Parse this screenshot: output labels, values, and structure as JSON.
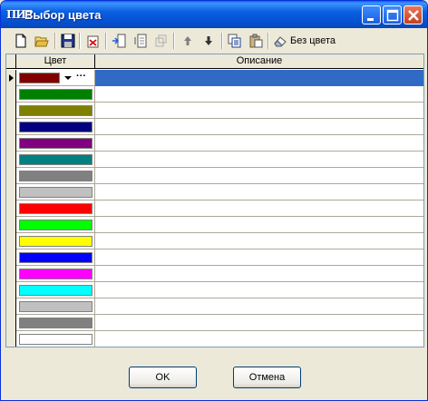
{
  "window": {
    "title": "Выбор цвета",
    "app_icon_text": "ПИР"
  },
  "toolbar": {
    "no_color_label": "Без цвета",
    "icons": [
      "new-icon",
      "open-icon",
      "save-icon",
      "delete-icon",
      "insert-icon",
      "copy-row-icon",
      "paste-row-icon",
      "move-up-icon",
      "move-down-icon",
      "copy-icon",
      "paste-icon",
      "eraser-icon"
    ]
  },
  "grid": {
    "columns": [
      "Цвет",
      "Описание"
    ],
    "rows": [
      {
        "color": "#800000",
        "description": "",
        "selected": true
      },
      {
        "color": "#008000",
        "description": ""
      },
      {
        "color": "#808000",
        "description": ""
      },
      {
        "color": "#000080",
        "description": ""
      },
      {
        "color": "#800080",
        "description": ""
      },
      {
        "color": "#008080",
        "description": ""
      },
      {
        "color": "#808080",
        "description": ""
      },
      {
        "color": "#c0c0c0",
        "description": ""
      },
      {
        "color": "#ff0000",
        "description": ""
      },
      {
        "color": "#00ff00",
        "description": ""
      },
      {
        "color": "#ffff00",
        "description": ""
      },
      {
        "color": "#0000ff",
        "description": ""
      },
      {
        "color": "#ff00ff",
        "description": ""
      },
      {
        "color": "#00ffff",
        "description": ""
      },
      {
        "color": "#c0c0c0",
        "description": ""
      },
      {
        "color": "#808080",
        "description": ""
      },
      {
        "color": "#ffffff",
        "description": ""
      }
    ]
  },
  "buttons": {
    "ok": "OK",
    "cancel": "Отмена"
  },
  "colors": {
    "selection": "#316ac5",
    "title_bar": "#0a5fe0"
  }
}
